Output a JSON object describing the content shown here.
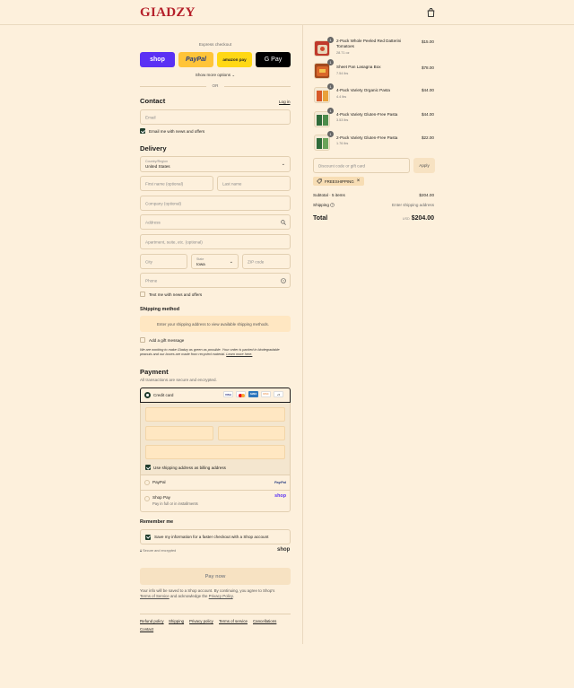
{
  "header": {
    "logo": "GIADZY",
    "cart_icon": "shopping-bag-icon"
  },
  "express": {
    "title": "Express checkout",
    "buttons": [
      {
        "label": "shop",
        "color": "#5a31f4"
      },
      {
        "label": "PayPal",
        "color": "#ffc439"
      },
      {
        "label": "amazon pay",
        "color": "#ffd814"
      },
      {
        "label": "G Pay",
        "color": "#000000"
      }
    ],
    "show_more": "Show more options",
    "or": "OR"
  },
  "contact": {
    "title": "Contact",
    "login": "Log in",
    "email_placeholder": "Email",
    "email_news": "Email me with news and offers"
  },
  "delivery": {
    "title": "Delivery",
    "country_label": "Country/Region",
    "country_value": "United States",
    "first_name": "First name (optional)",
    "last_name": "Last name",
    "company": "Company (optional)",
    "address": "Address",
    "apartment": "Apartment, suite, etc. (optional)",
    "city": "City",
    "state_label": "State",
    "state_value": "Iowa",
    "zip": "ZIP code",
    "phone": "Phone",
    "text_news": "Text me with news and offers"
  },
  "shipping": {
    "title": "Shipping method",
    "notice": "Enter your shipping address to view available shipping methods.",
    "gift": "Add a gift message",
    "eco_text_1": "We are working to make Giadzy as green as possible. Your order is packed in biodegradable",
    "eco_text_2": "peanuts and our boxes are made from recycled material.",
    "learn_more": "Learn more here."
  },
  "payment": {
    "title": "Payment",
    "subtitle": "All transactions are secure and encrypted.",
    "credit_card": "Credit card",
    "card_brands": [
      "VISA",
      "MC",
      "AMEX",
      "DISC",
      "+5"
    ],
    "billing_same": "Use shipping address as billing address",
    "paypal": "PayPal",
    "paypal_logo": "PayPal",
    "shop_pay": "Shop Pay",
    "shop_pay_sub": "Pay in full or in installments",
    "shop_logo": "shop"
  },
  "remember": {
    "title": "Remember me",
    "save": "Save my information for a faster checkout with a Shop account",
    "secure": "Secure and encrypted",
    "shop_logo": "shop"
  },
  "pay_button": "Pay now",
  "legal": {
    "line1": "Your info will be saved to a Shop account. By continuing, you agree to Shop's",
    "tos": "Terms of Service",
    "and": "and acknowledge the",
    "privacy": "Privacy Policy",
    "period": "."
  },
  "footer_links": [
    "Refund policy",
    "Shipping",
    "Privacy policy",
    "Terms of service",
    "Cancellations",
    "Contact"
  ],
  "order": {
    "items": [
      {
        "qty": "1",
        "name": "2-Pack Whole Peeled Red Datterini Tomatoes",
        "sub": "28.71 oz",
        "price": "$15.00"
      },
      {
        "qty": "1",
        "name": "Sheet Pan Lasagna Box",
        "sub": "7.54 lbs",
        "price": "$78.00"
      },
      {
        "qty": "1",
        "name": "4-Pack Variety Organic Pasta",
        "sub": "4.4 lbs",
        "price": "$44.00"
      },
      {
        "qty": "1",
        "name": "4-Pack Variety Gluten-Free Pasta",
        "sub": "3.53 lbs",
        "price": "$44.00"
      },
      {
        "qty": "1",
        "name": "2-Pack Variety Gluten-Free Pasta",
        "sub": "1.76 lbs",
        "price": "$22.00"
      }
    ],
    "discount_placeholder": "Discount code or gift card",
    "apply": "Apply",
    "tag": "FREESHIPPING",
    "subtotal_label": "Subtotal · 5 items",
    "subtotal_value": "$204.00",
    "shipping_label": "Shipping",
    "shipping_value": "Enter shipping address",
    "total_label": "Total",
    "currency": "USD",
    "total_value": "$204.00"
  }
}
